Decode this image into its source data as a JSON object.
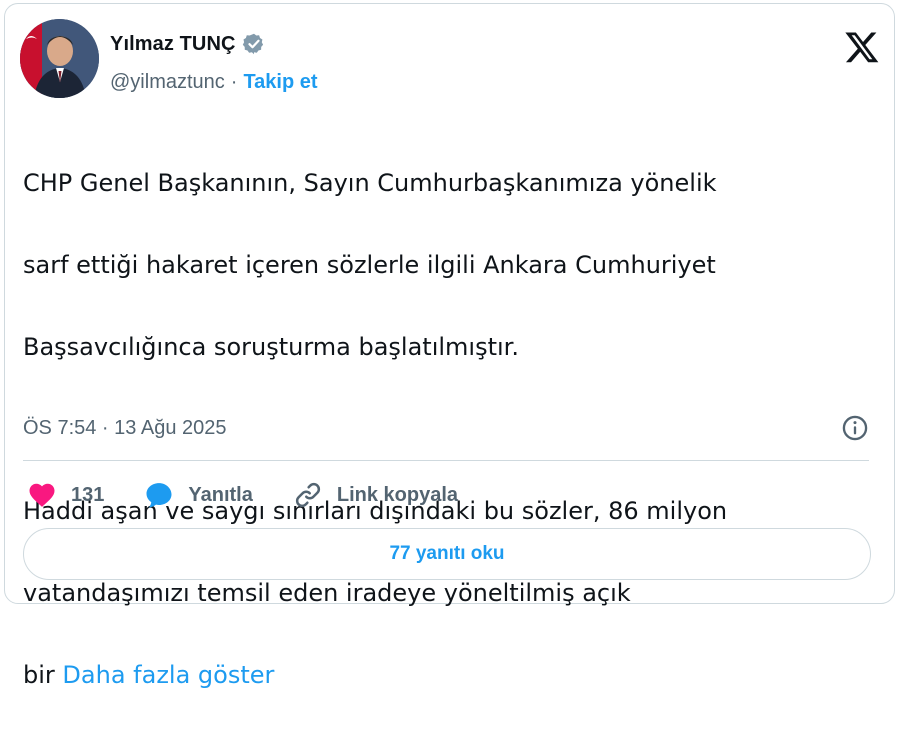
{
  "author": {
    "name": "Yılmaz TUNÇ",
    "handle": "@yilmaztunc",
    "separator": "·",
    "follow_label": "Takip et"
  },
  "tweet": {
    "line1": "CHP Genel Başkanının, Sayın Cumhurbaşkanımıza yönelik",
    "line2": "sarf ettiği hakaret içeren sözlerle ilgili Ankara Cumhuriyet",
    "line3": "Başsavcılığınca soruşturma başlatılmıştır.",
    "line4": "Haddi aşan ve saygı sınırları dışındaki bu sözler, 86 milyon",
    "line5": "vatandaşımızı temsil eden iradeye yöneltilmiş açık",
    "line6_prefix": "bir",
    "show_more": "Daha fazla göster"
  },
  "meta": {
    "timestamp": "ÖS 7:54 · 13 Ağu 2025"
  },
  "actions": {
    "like_count": "131",
    "reply_label": "Yanıtla",
    "copy_link_label": "Link kopyala"
  },
  "replies_button": "77 yanıtı oku",
  "colors": {
    "accent": "#1d9bf0",
    "like": "#f91880",
    "secondary_text": "#536471",
    "border": "#cfd9de"
  },
  "icons": [
    "verified-badge-icon",
    "x-logo-icon",
    "info-icon",
    "heart-icon",
    "reply-bubble-icon",
    "link-icon"
  ]
}
